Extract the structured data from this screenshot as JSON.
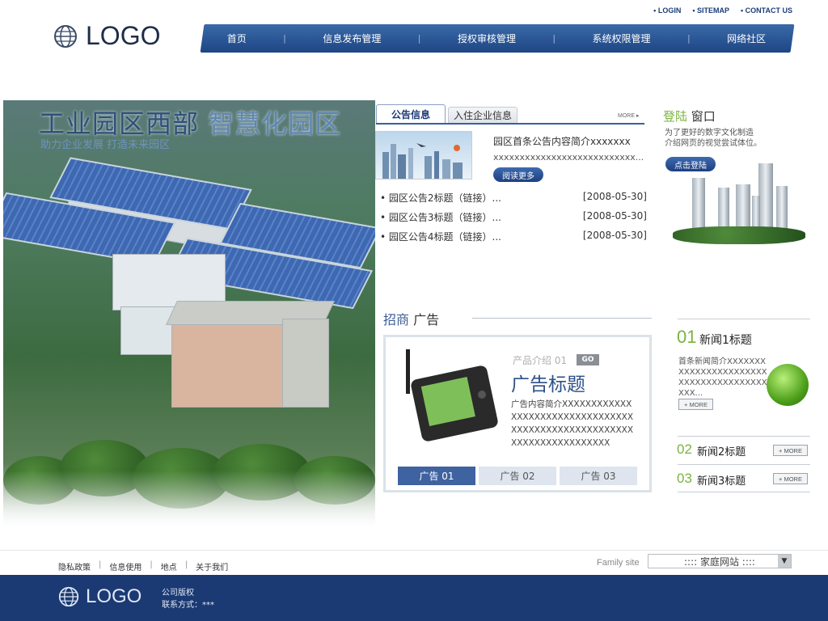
{
  "header": {
    "links": [
      "LOGIN",
      "SITEMAP",
      "CONTACT US"
    ],
    "logo_text": "LOGO",
    "nav": [
      "首页",
      "信息发布管理",
      "授权审核管理",
      "系统权限管理",
      "网络社区"
    ]
  },
  "hero": {
    "title_main": "工业园区西部",
    "title_highlight": "智慧化园区",
    "subtitle": "助力企业发展   打造未来园区"
  },
  "notice": {
    "tabs": [
      "公告信息",
      "入住企业信息"
    ],
    "more": "MORE ▸",
    "intro_title": "园区首条公告内容简介xxxxxxx",
    "intro_body": "xxxxxxxxxxxxxxxxxxxxxxxxxxx...",
    "read_more": "阅读更多",
    "items": [
      {
        "title": "园区公告2标题（链接）...",
        "date": "[2008-05-30]"
      },
      {
        "title": "园区公告3标题（链接）...",
        "date": "[2008-05-30]"
      },
      {
        "title": "园区公告4标题（链接）...",
        "date": "[2008-05-30]"
      }
    ]
  },
  "login": {
    "title_green": "登陆",
    "title_dark": "窗口",
    "desc_line1": "为了更好的数字文化制造",
    "desc_line2": "介绍网页的视觉尝试体位。",
    "button": "点击登陆"
  },
  "ad": {
    "title_blue": "招商",
    "title_dark": "广告",
    "kicker": "产品介绍 01",
    "go": "GO",
    "headline": "广告标题",
    "body": "广告内容简介XXXXXXXXXXXXXXXXXXXXXXXXXXXXXXXXXXXXXXXXXXXXXXXXXXXXXXXXXXXXXXXXXXXXXXX",
    "tabs": [
      "广告 01",
      "广告 02",
      "广告 03"
    ]
  },
  "news": {
    "items": [
      {
        "num": "01",
        "title": "新闻1标题",
        "desc": "首条新闻简介XXXXXXXXXXXXXXXXXXXXXXXXXXXXXXXXXXXXXXXXXX..."
      },
      {
        "num": "02",
        "title": "新闻2标题"
      },
      {
        "num": "03",
        "title": "新闻3标题"
      }
    ],
    "more": "+ MORE"
  },
  "footer": {
    "links": [
      "隐私政策",
      "信息使用",
      "地点",
      "关于我们"
    ],
    "family_label": "Family site",
    "family_value": "::::           家庭网站           ::::",
    "logo_text": "LOGO",
    "company": "公司版权",
    "contact": "联系方式：***"
  },
  "colors": {
    "brand_blue": "#1d3f80",
    "accent_green": "#7bb33f"
  }
}
